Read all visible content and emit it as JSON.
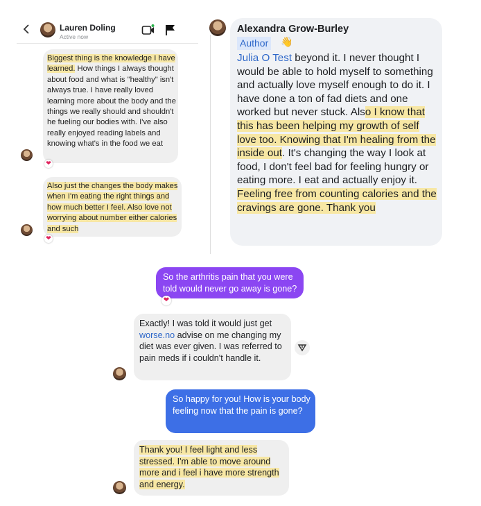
{
  "panel1": {
    "header": {
      "name": "Lauren Doling",
      "status": "Active now"
    },
    "msg1": {
      "hl": "Biggest thing is the knowledge I have learned.",
      "rest": " How things I always thought about food and what is \"healthy\" isn't always true. I have really loved learning more about the body and the things we really should and shouldn't he fueling our bodies with. I've also really enjoyed reading labels and knowing what's in the food we eat"
    },
    "msg2": {
      "text": "Also just the changes the body makes when I'm eating the right things and how much better I feel. Also love not worrying about number either calories and such"
    },
    "reaction": "❤"
  },
  "panel2": {
    "name": "Alexandra Grow-Burley",
    "author_badge": "Author",
    "wave": "👋",
    "mention": "Julia O Test",
    "t1": " beyond it.  I never thought I would be able to hold myself to something and actually love myself enough to do it.  I have done a ton of fad diets and one worked but never stuck.  Als",
    "h1": "o I know that this has been helping my growth of self love too.  Knowing that I'm healing from the inside out",
    "t2": ". It's changing the way I look at food, I don't feel bad for feeling hungry or eating more.  I eat and actually enjoy it.  ",
    "h2": "Feeling free from counting calories and the cravings are gone.  Thank you"
  },
  "panel3": {
    "sent1": "So the arthritis pain that you were told would never go away is gone?",
    "reply1_a": "Exactly! I was told it would just get ",
    "reply1_link": "worse.no",
    "reply1_b": " advise on me changing my diet was ever given. I was referred to pain meds if i couldn't handle it.",
    "sent2": "So happy for you! How is your body feeling now that the pain is gone?",
    "reply2": "Thank you! I feel light and less stressed. I'm able to move around more and i feel i have more strength and energy.",
    "reaction": "❤"
  }
}
